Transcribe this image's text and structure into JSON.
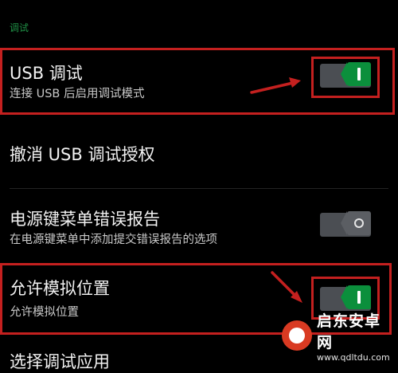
{
  "section": {
    "header": "调试"
  },
  "rows": [
    {
      "title": "USB 调试",
      "subtitle": "连接 USB 后启用调试模式",
      "toggle": "on"
    },
    {
      "title": "撤消 USB 调试授权"
    },
    {
      "title": "电源键菜单错误报告",
      "subtitle": "在电源键菜单中添加提交错误报告的选项",
      "toggle": "off"
    },
    {
      "title": "允许模拟位置",
      "subtitle": "允许模拟位置",
      "toggle": "on"
    }
  ],
  "next_row_partial": "选择调试应用",
  "watermark": {
    "name": "启东安卓网",
    "url": "www.qdltdu.com"
  },
  "colors": {
    "accent": "#0b8f3c",
    "highlight": "#c4201f",
    "background": "#000000"
  }
}
